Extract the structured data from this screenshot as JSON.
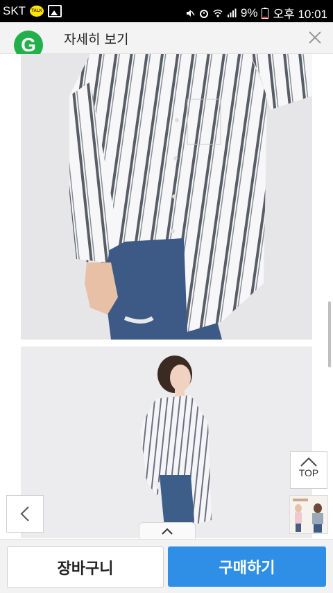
{
  "status_bar": {
    "carrier": "SKT",
    "talk_badge": "TALK",
    "battery": "9%",
    "time": "오후 10:01"
  },
  "header": {
    "logo_letter": "G",
    "title": "자세히 보기"
  },
  "floating": {
    "top_label": "TOP"
  },
  "bottom_bar": {
    "cart_label": "장바구니",
    "buy_label": "구매하기"
  },
  "colors": {
    "logo": "#21b04a",
    "buy_button": "#2f8fe6"
  }
}
